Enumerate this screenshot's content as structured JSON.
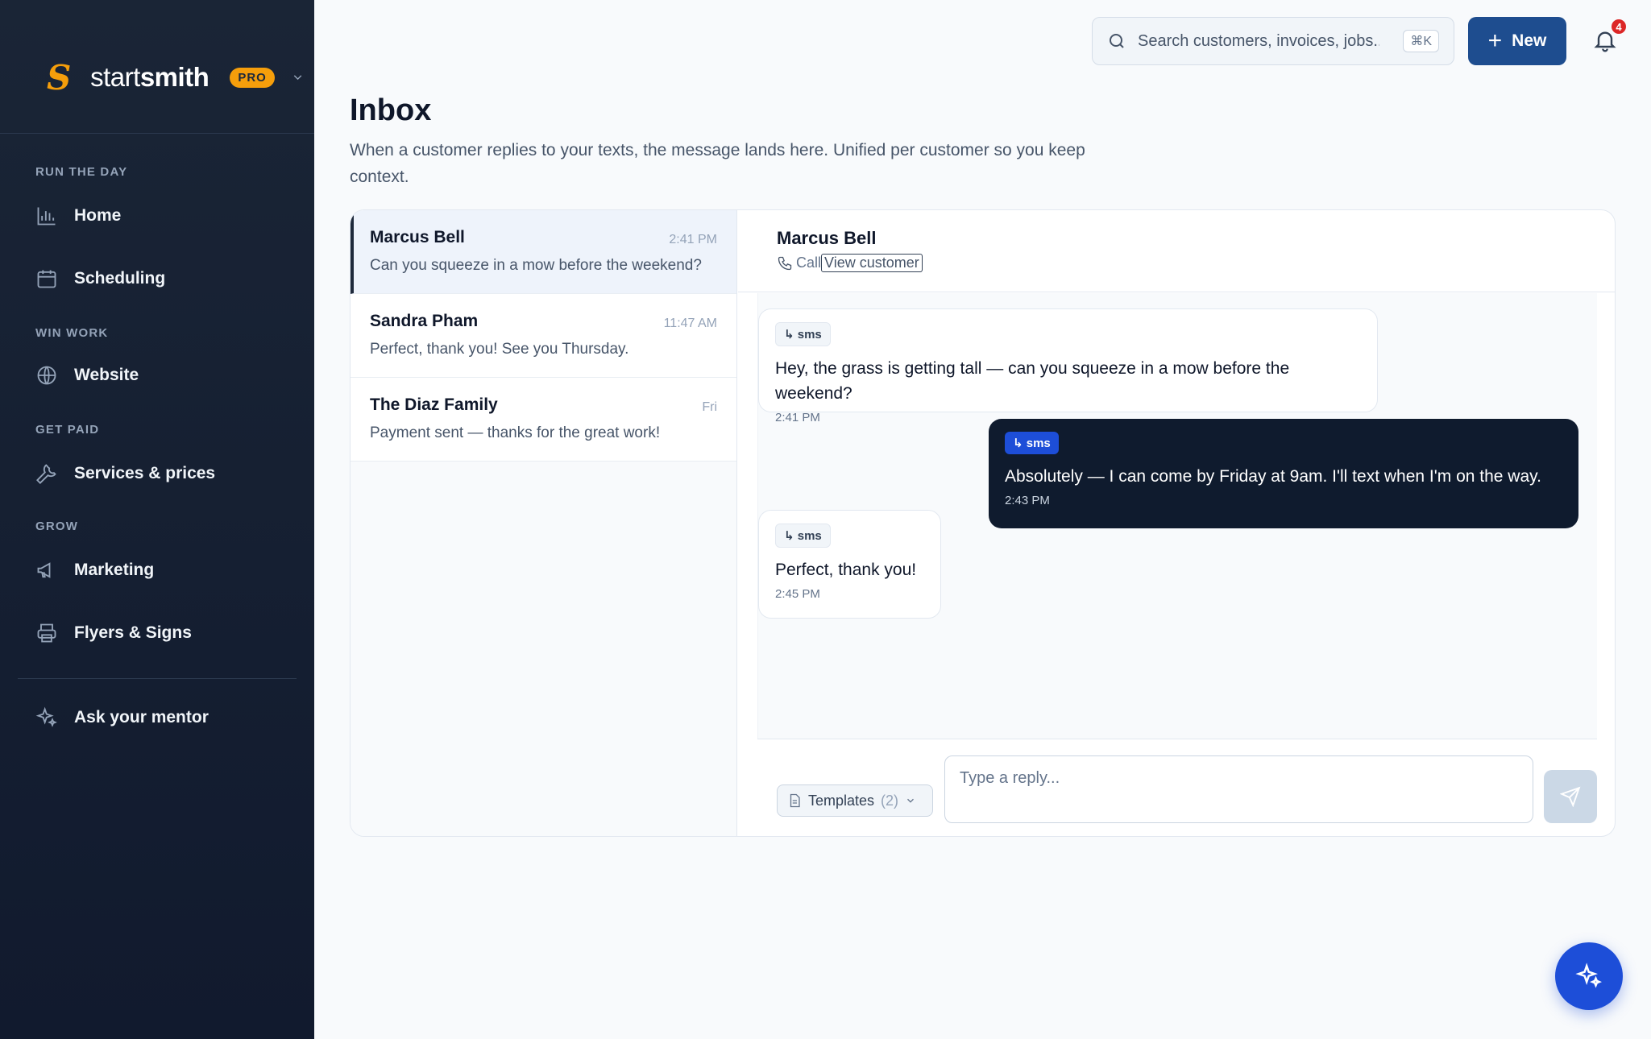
{
  "brand": {
    "name_light": "start",
    "name_bold": "smith",
    "plan_badge": "PRO"
  },
  "nav": {
    "sections": [
      "RUN THE DAY",
      "WIN WORK",
      "GET PAID",
      "GROW"
    ],
    "items": [
      {
        "label": "Home",
        "icon": "bar-chart-icon"
      },
      {
        "label": "Scheduling",
        "icon": "calendar-icon"
      },
      {
        "label": "Website",
        "icon": "globe-icon"
      },
      {
        "label": "Services & prices",
        "icon": "wrench-icon"
      },
      {
        "label": "Marketing",
        "icon": "megaphone-icon"
      },
      {
        "label": "Flyers & Signs",
        "icon": "printer-icon"
      }
    ],
    "mentor_label": "Ask your mentor"
  },
  "topbar": {
    "search_placeholder": "Search customers, invoices, jobs...",
    "search_shortcut": "⌘K",
    "new_label": "New",
    "notification_count": "4"
  },
  "page": {
    "title": "Inbox",
    "subtitle": "When a customer replies to your texts, the message lands here. Unified per customer so you keep context."
  },
  "conversations": [
    {
      "name": "Marcus Bell",
      "time": "2:41 PM",
      "preview": "Can you squeeze in a mow before the weekend?",
      "active": true
    },
    {
      "name": "Sandra Pham",
      "time": "11:47 AM",
      "preview": "Perfect, thank you! See you Thursday.",
      "active": false
    },
    {
      "name": "The Diaz Family",
      "time": "Fri",
      "preview": "Payment sent — thanks for the great work!",
      "active": false
    }
  ],
  "thread": {
    "customer_name": "Marcus Bell",
    "call_label": "Call",
    "view_customer_label": "View customer",
    "messages": [
      {
        "direction": "inbound",
        "channel": "↳ sms",
        "text": "Hey, the grass is getting tall — can you squeeze in a mow before the weekend?",
        "time": "2:41 PM"
      },
      {
        "direction": "outbound",
        "channel": "↳ sms",
        "text": "Absolutely — I can come by Friday at 9am. I'll text when I'm on the way.",
        "time": "2:43 PM"
      },
      {
        "direction": "inbound",
        "channel": "↳ sms",
        "text": "Perfect, thank you!",
        "time": "2:45 PM"
      }
    ]
  },
  "composer": {
    "templates_label": "Templates",
    "templates_count": "(2)",
    "reply_placeholder": "Type a reply..."
  },
  "colors": {
    "sidebar_bg": "#111a2e",
    "accent": "#1e4d8f",
    "brand_orange": "#f59e0b",
    "outbound_bubble": "#0f1b2e",
    "notification": "#dc2626"
  }
}
